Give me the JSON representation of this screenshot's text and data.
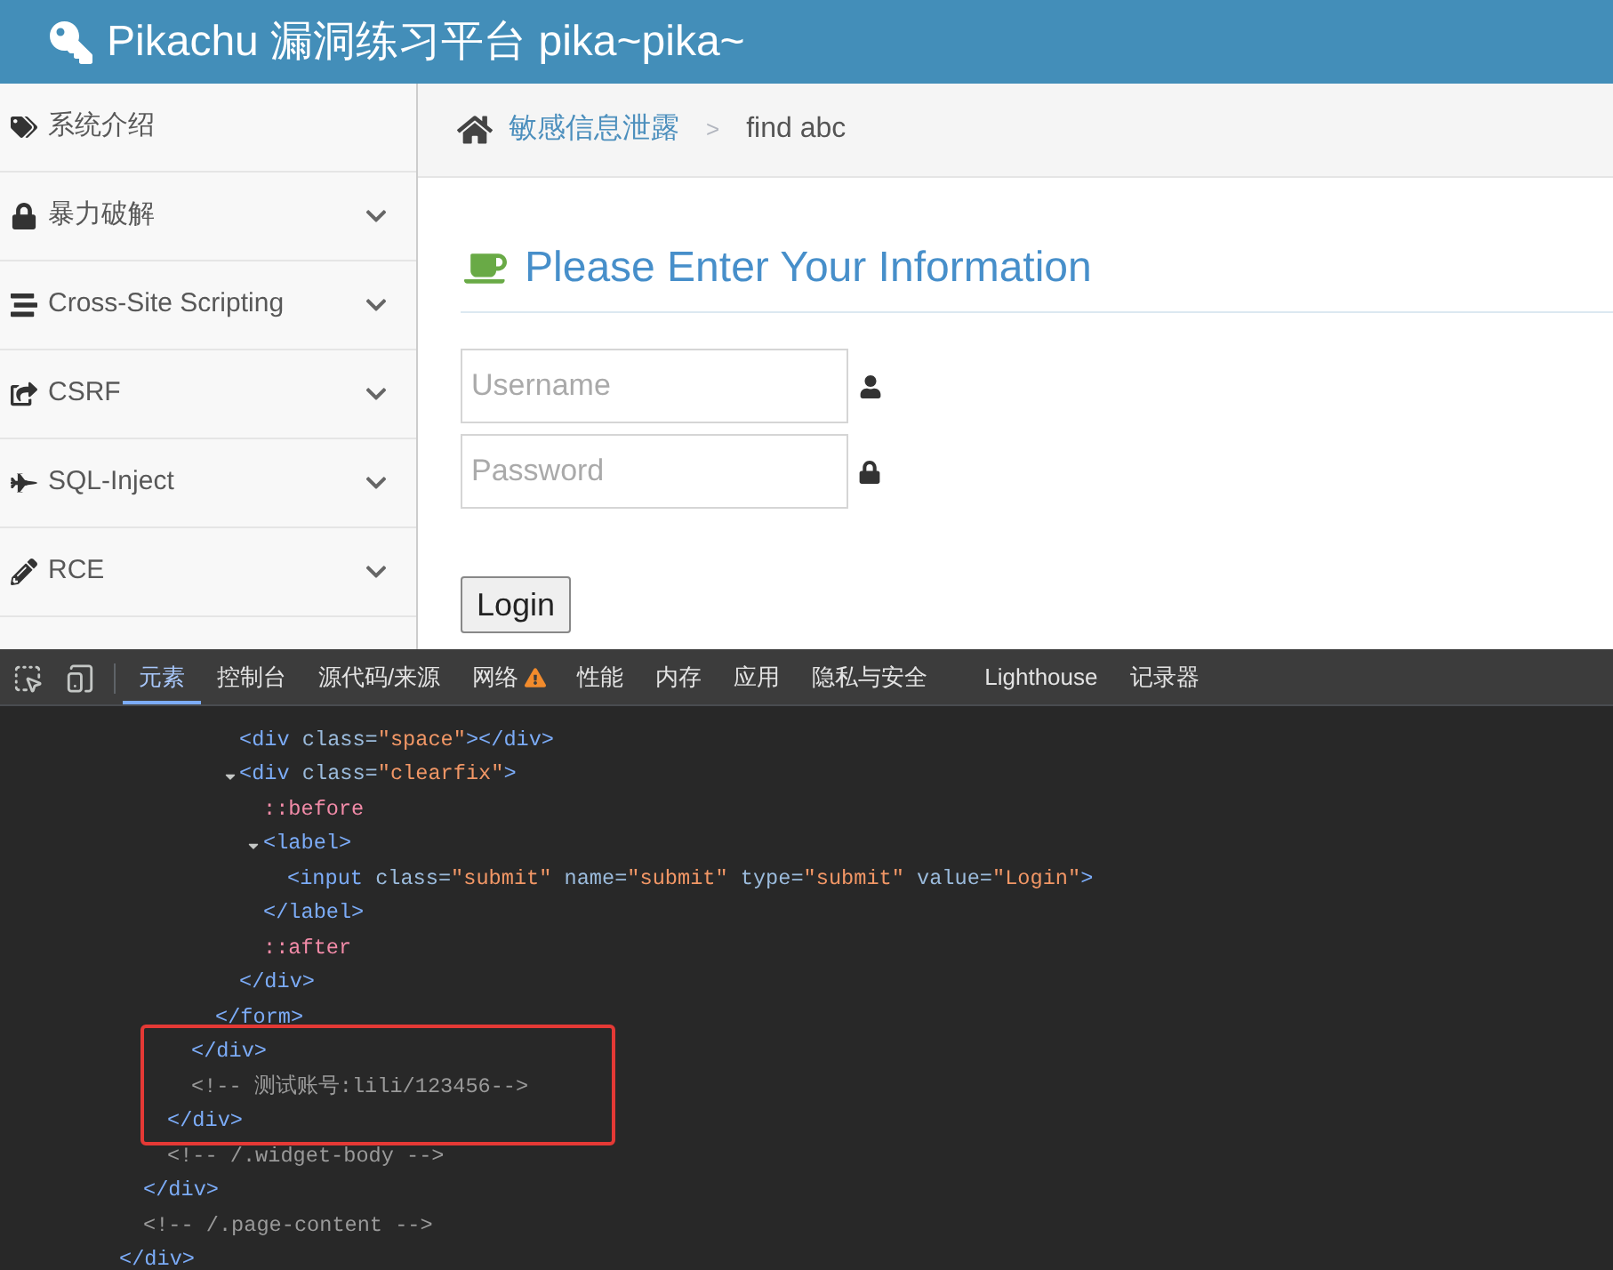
{
  "header": {
    "title": "Pikachu 漏洞练习平台 pika~pika~"
  },
  "sidebar": {
    "items": [
      {
        "label": "系统介绍",
        "kind": "link"
      },
      {
        "label": "暴力破解",
        "kind": "menu"
      },
      {
        "label": "Cross-Site Scripting",
        "kind": "menu"
      },
      {
        "label": "CSRF",
        "kind": "menu"
      },
      {
        "label": "SQL-Inject",
        "kind": "menu"
      },
      {
        "label": "RCE",
        "kind": "menu"
      }
    ]
  },
  "breadcrumb": {
    "items": [
      "敏感信息泄露",
      "find abc"
    ],
    "separator": ">"
  },
  "form": {
    "title": "Please Enter Your Information",
    "username": {
      "placeholder": "Username"
    },
    "password": {
      "placeholder": "Password"
    },
    "button": "Login"
  },
  "devtools": {
    "tabs": [
      {
        "label": "元素",
        "selected": true,
        "warning": false
      },
      {
        "label": "控制台",
        "selected": false,
        "warning": false
      },
      {
        "label": "源代码/来源",
        "selected": false,
        "warning": false
      },
      {
        "label": "网络",
        "selected": false,
        "warning": true
      },
      {
        "label": "性能",
        "selected": false,
        "warning": false
      },
      {
        "label": "内存",
        "selected": false,
        "warning": false
      },
      {
        "label": "应用",
        "selected": false,
        "warning": false
      },
      {
        "label": "隐私与安全",
        "selected": false,
        "warning": false
      },
      {
        "label": "Lighthouse",
        "selected": false,
        "warning": false
      },
      {
        "label": "记录器",
        "selected": false,
        "warning": false
      }
    ],
    "tree": [
      {
        "children": [
          {
            "children": [
              {
                "children": [
                  {
                    "children": [
                      {
                        "children": [
                          {
                            "tokens": [
                              {
                                "kind": "tag",
                                "text": "<div"
                              },
                              {
                                "kind": "attr",
                                "text": " class="
                              },
                              {
                                "kind": "value",
                                "text": "\"space\""
                              },
                              {
                                "kind": "tag",
                                "text": "></div>"
                              }
                            ]
                          },
                          {
                            "expanded": true,
                            "tokens": [
                              {
                                "kind": "tag",
                                "text": "<div"
                              },
                              {
                                "kind": "attr",
                                "text": " class="
                              },
                              {
                                "kind": "value",
                                "text": "\"clearfix\""
                              },
                              {
                                "kind": "tag",
                                "text": ">"
                              }
                            ],
                            "children": [
                              {
                                "tokens": [
                                  {
                                    "kind": "pseudo",
                                    "text": "::before"
                                  }
                                ]
                              },
                              {
                                "expanded": true,
                                "tokens": [
                                  {
                                    "kind": "tag",
                                    "text": "<label>"
                                  }
                                ],
                                "children": [
                                  {
                                    "tokens": [
                                      {
                                        "kind": "tag",
                                        "text": "<input"
                                      },
                                      {
                                        "kind": "attr",
                                        "text": " class="
                                      },
                                      {
                                        "kind": "value",
                                        "text": "\"submit\""
                                      },
                                      {
                                        "kind": "attr",
                                        "text": " name="
                                      },
                                      {
                                        "kind": "value",
                                        "text": "\"submit\""
                                      },
                                      {
                                        "kind": "attr",
                                        "text": " type="
                                      },
                                      {
                                        "kind": "value",
                                        "text": "\"submit\""
                                      },
                                      {
                                        "kind": "attr",
                                        "text": " value="
                                      },
                                      {
                                        "kind": "value",
                                        "text": "\"Login\""
                                      },
                                      {
                                        "kind": "tag",
                                        "text": ">"
                                      }
                                    ]
                                  }
                                ]
                              },
                              {
                                "tokens": [
                                  {
                                    "kind": "tag",
                                    "text": "</label>"
                                  }
                                ]
                              },
                              {
                                "tokens": [
                                  {
                                    "kind": "pseudo",
                                    "text": "::after"
                                  }
                                ]
                              }
                            ]
                          },
                          {
                            "tokens": [
                              {
                                "kind": "tag",
                                "text": "</div>"
                              }
                            ]
                          }
                        ]
                      },
                      {
                        "tokens": [
                          {
                            "kind": "tag",
                            "text": "</form>"
                          }
                        ]
                      }
                    ]
                  },
                  {
                    "tokens": [
                      {
                        "kind": "tag",
                        "text": "</div>"
                      }
                    ]
                  },
                  {
                    "tokens": [
                      {
                        "kind": "comment",
                        "text": "<!-- 测试账号:lili/123456-->"
                      }
                    ]
                  }
                ]
              },
              {
                "tokens": [
                  {
                    "kind": "tag",
                    "text": "</div>"
                  }
                ]
              },
              {
                "tokens": [
                  {
                    "kind": "comment",
                    "text": "<!-- /.widget-body -->"
                  }
                ]
              }
            ]
          },
          {
            "tokens": [
              {
                "kind": "tag",
                "text": "</div>"
              }
            ]
          },
          {
            "tokens": [
              {
                "kind": "comment",
                "text": "<!-- /.page-content -->"
              }
            ]
          }
        ]
      },
      {
        "tokens": [
          {
            "kind": "tag",
            "text": "</div>"
          }
        ]
      }
    ]
  }
}
